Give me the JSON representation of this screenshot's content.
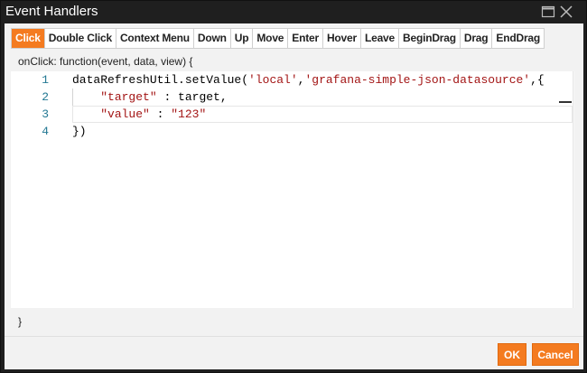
{
  "window": {
    "title": "Event Handlers",
    "maximize_icon": "maximize-icon",
    "close_icon": "close-icon"
  },
  "tabs": [
    {
      "label": "Click",
      "active": true
    },
    {
      "label": "Double Click",
      "active": false
    },
    {
      "label": "Context Menu",
      "active": false
    },
    {
      "label": "Down",
      "active": false
    },
    {
      "label": "Up",
      "active": false
    },
    {
      "label": "Move",
      "active": false
    },
    {
      "label": "Enter",
      "active": false
    },
    {
      "label": "Hover",
      "active": false
    },
    {
      "label": "Leave",
      "active": false
    },
    {
      "label": "BeginDrag",
      "active": false
    },
    {
      "label": "Drag",
      "active": false
    },
    {
      "label": "EndDrag",
      "active": false
    }
  ],
  "function_signature": "onClick: function(event, data, view) {",
  "code": {
    "lines": [
      {
        "number": "1",
        "segments": [
          [
            "dataRefreshUtil.setValue(",
            "plain"
          ],
          [
            "'local'",
            "str"
          ],
          [
            ",",
            "plain"
          ],
          [
            "'grafana-simple-json-datasource'",
            "str"
          ],
          [
            ",{",
            "plain"
          ]
        ]
      },
      {
        "number": "2",
        "segments": [
          [
            "    ",
            "plain"
          ],
          [
            "\"target\"",
            "str"
          ],
          [
            " : target,",
            "plain"
          ]
        ]
      },
      {
        "number": "3",
        "segments": [
          [
            "    ",
            "plain"
          ],
          [
            "\"value\"",
            "str"
          ],
          [
            " : ",
            "plain"
          ],
          [
            "\"123\"",
            "str"
          ]
        ]
      },
      {
        "number": "4",
        "segments": [
          [
            "})",
            "plain"
          ]
        ]
      }
    ]
  },
  "closing_brace": "}",
  "buttons": {
    "ok": "OK",
    "cancel": "Cancel"
  },
  "colors": {
    "accent": "#f47b20",
    "title_bar": "#1f1f1f",
    "line_number": "#237893",
    "string": "#a31515"
  }
}
